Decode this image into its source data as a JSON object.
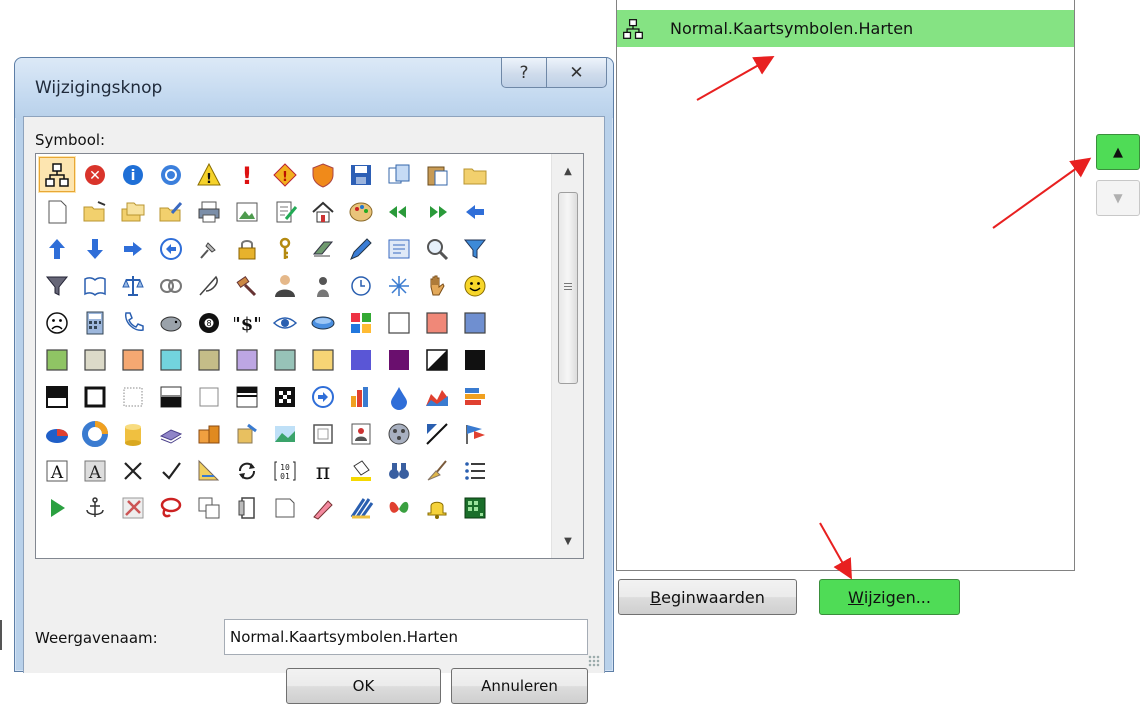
{
  "dialog": {
    "title": "Wijzigingsknop",
    "help_label": "?",
    "close_label": "✕",
    "symbol_label": "Symbool:",
    "display_name_label": "Weergavenaam:",
    "display_name_value": "Normal.Kaartsymbolen.Harten",
    "ok_label": "OK",
    "cancel_label": "Annuleren",
    "selected_symbol_index": 0,
    "symbols": [
      "diagram-icon",
      "error-icon",
      "info-icon",
      "circle-icon",
      "warning-icon",
      "exclamation-icon",
      "diamond-warning-icon",
      "shield-icon",
      "save-icon",
      "copy-icon",
      "paste-icon",
      "folder-icon",
      "new-document-icon",
      "folder-open-icon",
      "copy-folder-icon",
      "folder-edit-icon",
      "print-icon",
      "picture-icon",
      "edit-document-icon",
      "home-icon",
      "palette-icon",
      "arrow-left-double-icon",
      "arrow-right-double-icon",
      "arrow-left-icon",
      "arrow-up-icon",
      "arrow-down-icon",
      "arrow-right-icon",
      "back-circle-icon",
      "pin-icon",
      "lock-icon",
      "key-icon",
      "eraser-icon",
      "pencil-icon",
      "form-icon",
      "magnifier-icon",
      "funnel-icon",
      "funnel-dark-icon",
      "book-icon",
      "balance-icon",
      "rings-icon",
      "feather-icon",
      "gavel-icon",
      "person-icon",
      "person-alt-icon",
      "clock-icon",
      "sparkle-icon",
      "hand-icon",
      "smile-icon",
      "sad-icon",
      "calculator-icon",
      "phone-icon",
      "piggy-bank-icon",
      "eight-ball-icon",
      "dollar-icon",
      "eye-icon",
      "disk-icon",
      "colors-icon",
      "white-square-icon",
      "salmon-square-icon",
      "blue-square-icon",
      "green-square-icon",
      "beige-square-icon",
      "orange-square-icon",
      "cyan-square-icon",
      "olive-square-icon",
      "lavender-square-icon",
      "teal-square-icon",
      "yellow-square-icon",
      "violet-square-icon",
      "purple-square-icon",
      "diagonal-square-icon",
      "black-square-icon",
      "top-dark-square-icon",
      "frame-square-icon",
      "dotted-square-icon",
      "bottom-half-square-icon",
      "empty-square-icon",
      "stripe-square-icon",
      "checker-square-icon",
      "next-circle-icon",
      "bar-chart-icon",
      "drop-icon",
      "area-chart-icon",
      "stacked-bars-icon",
      "pie-chart-icon",
      "donut-icon",
      "cylinder-icon",
      "books-icon",
      "cubes-icon",
      "boxes-icon",
      "landscape-icon",
      "frame-icon",
      "portrait-icon",
      "film-icon",
      "pen-stroke-icon",
      "flags-icon",
      "text-a-icon",
      "text-a-dark-icon",
      "cross-icon",
      "check-icon",
      "ruler-icon",
      "refresh-icon",
      "binary-icon",
      "pi-icon",
      "paint-bucket-icon",
      "binoculars-icon",
      "broom-icon",
      "list-icon",
      "play-icon",
      "anchor-icon",
      "tools-icon",
      "lasso-icon",
      "copy-pages-icon",
      "document-stack-icon",
      "blank-page-icon",
      "marker-icon",
      "stripes-icon",
      "butterfly-icon",
      "bell-icon",
      "matrix-icon"
    ]
  },
  "panel": {
    "list_item_label": "Normal.Kaartsymbolen.Harten",
    "list_item_icon": "diagram-icon",
    "begin_label_u": "B",
    "begin_label_rest": "eginwaarden",
    "wijz_label_u": "W",
    "wijz_label_rest": "ijzigen...",
    "up_label": "▲",
    "down_label": "▼",
    "highlight_color": "#85e383",
    "button_green": "#4fdc56",
    "arrow_color": "#e82020"
  }
}
